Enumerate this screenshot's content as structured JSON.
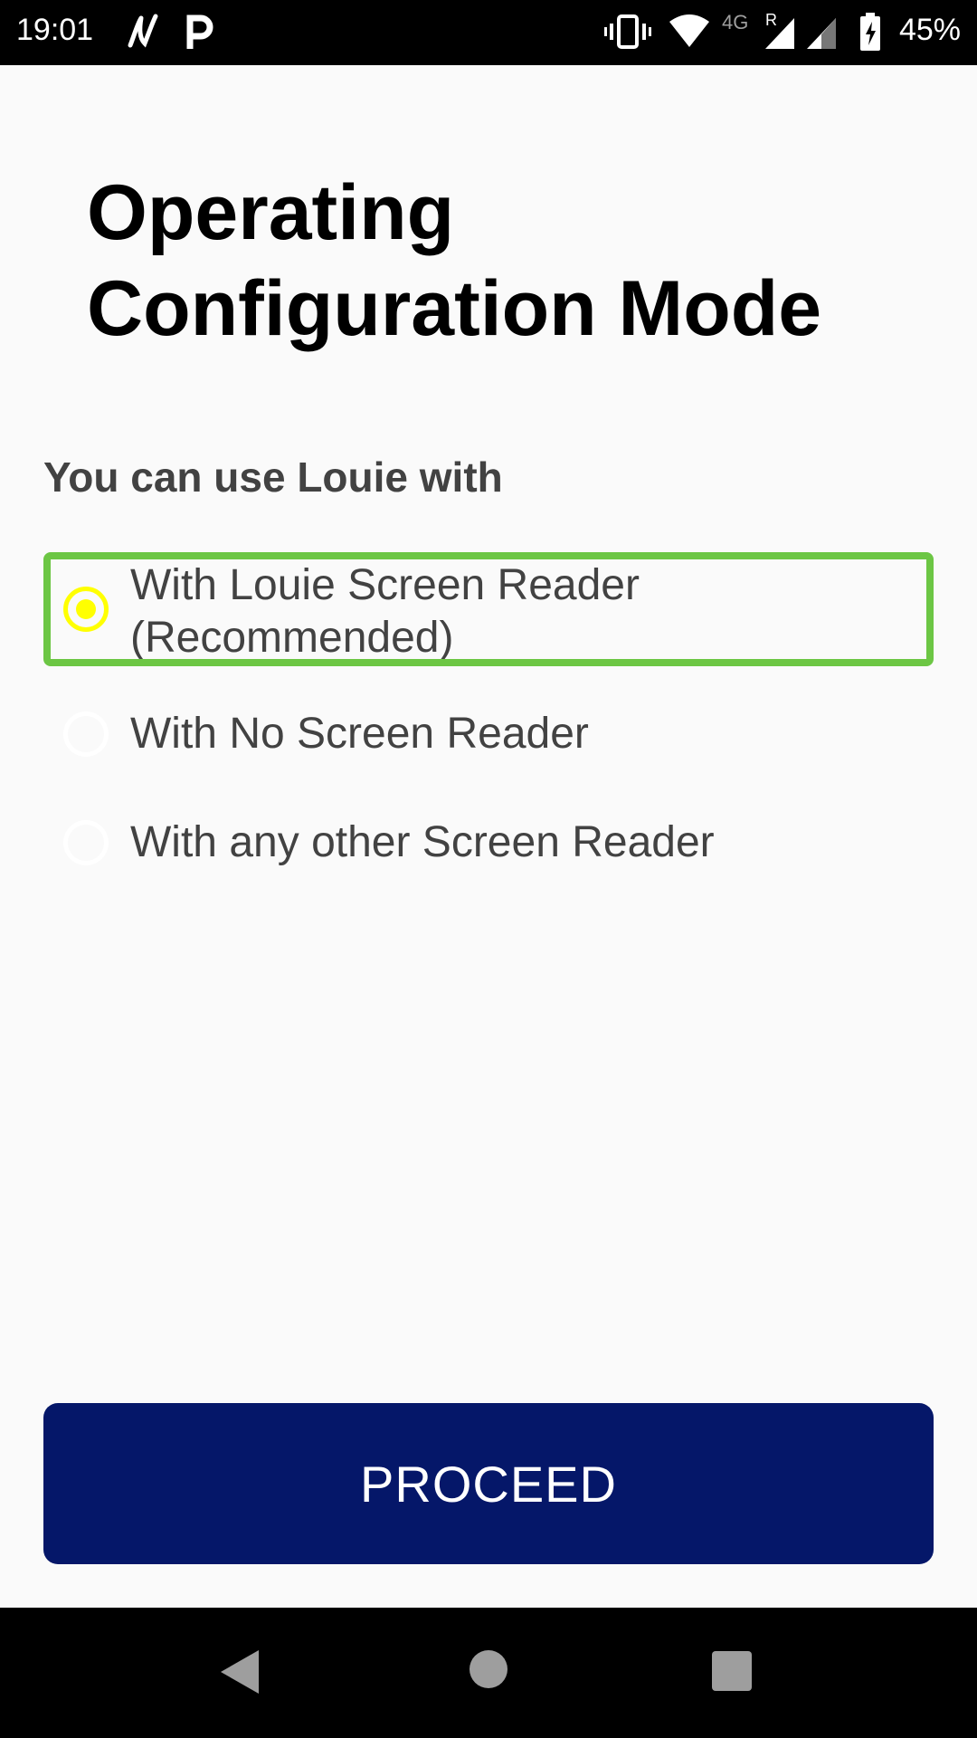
{
  "status_bar": {
    "time": "19:01",
    "network_label": "4G",
    "roaming_label": "R",
    "battery_percent": "45%",
    "icons": [
      "app-n-icon",
      "p-icon",
      "vibrate-icon",
      "wifi-icon",
      "signal-icon",
      "signal-icon-2",
      "battery-icon"
    ]
  },
  "screen": {
    "title": "Operating Configuration Mode",
    "subtitle": "You can use Louie with",
    "options": [
      {
        "label": "With Louie Screen Reader (Recommended)",
        "selected": true
      },
      {
        "label": "With No Screen Reader",
        "selected": false
      },
      {
        "label": "With any other Screen Reader",
        "selected": false
      }
    ],
    "proceed_label": "PROCEED"
  },
  "colors": {
    "background": "#fafafa",
    "title": "#000000",
    "label": "#424242",
    "radio_selected": "#ffff00",
    "focus_ring": "#6cc644",
    "button": "#051769",
    "button_text": "#ffffff"
  },
  "nav_bar": {
    "icons": [
      "back-icon",
      "home-icon",
      "recents-icon"
    ]
  }
}
